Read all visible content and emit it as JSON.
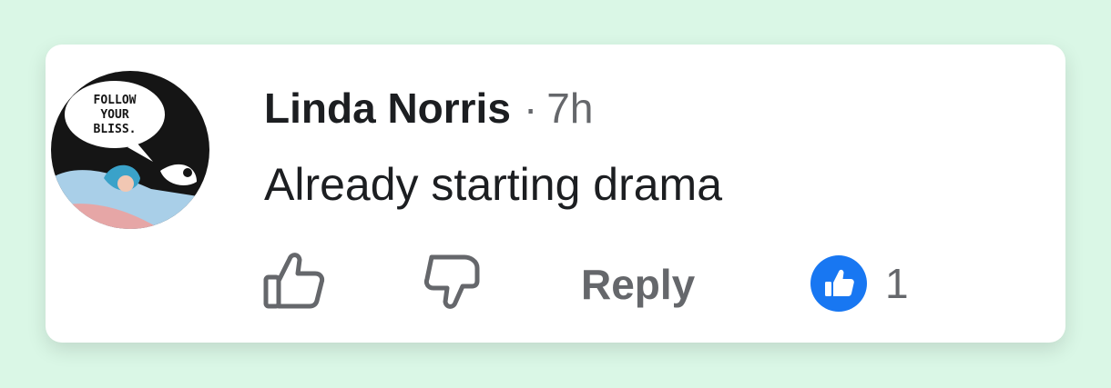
{
  "comment": {
    "author": "Linda Norris",
    "separator": "·",
    "time": "7h",
    "text": "Already starting drama",
    "avatar_caption": [
      "FOLLOW",
      "YOUR",
      "BLISS."
    ]
  },
  "actions": {
    "like_icon": "thumbs-up-outline-icon",
    "dislike_icon": "thumbs-down-outline-icon",
    "reply_label": "Reply"
  },
  "reactions": {
    "icon": "like-reaction-icon",
    "count": "1"
  },
  "colors": {
    "background": "#daf7e6",
    "card": "#ffffff",
    "text_primary": "#1c1e21",
    "text_secondary": "#65676b",
    "like_blue": "#1877f2"
  }
}
